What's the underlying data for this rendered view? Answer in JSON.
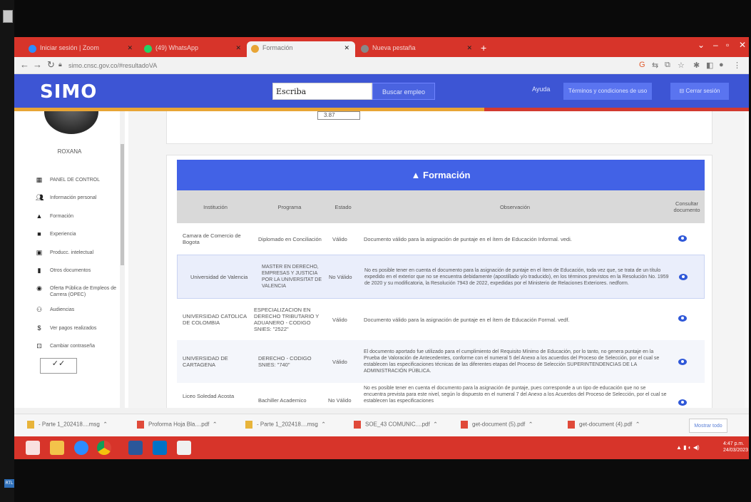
{
  "browser": {
    "tabs": [
      {
        "label": "Iniciar sesión | Zoom",
        "active": false,
        "color": "#2d8cff"
      },
      {
        "label": "(49) WhatsApp",
        "active": false,
        "color": "#25d366"
      },
      {
        "label": "Formación",
        "active": true,
        "color": "#e8a536"
      },
      {
        "label": "Nueva pestaña",
        "active": false,
        "color": "#888888"
      }
    ],
    "url": "simo.cnsc.gov.co/#resultadoVA"
  },
  "site": {
    "logo": "SIMO",
    "search_value": "Escriba",
    "search_button": "Buscar empleo",
    "help": "Ayuda",
    "terms_button": "Términos y condiciones de uso",
    "logout_button": "Cerrar sesión"
  },
  "sidebar": {
    "username": "ROXANA",
    "items": [
      {
        "label": "PANEL DE CONTROL",
        "icon": "dashboard-icon"
      },
      {
        "label": "Información personal",
        "icon": "people-icon"
      },
      {
        "label": "Formación",
        "icon": "graduation-icon"
      },
      {
        "label": "Experiencia",
        "icon": "briefcase-icon"
      },
      {
        "label": "Producc. intelectual",
        "icon": "book-icon"
      },
      {
        "label": "Otros documentos",
        "icon": "document-icon"
      },
      {
        "label": "Oferta Pública de Empleos de Carrera (OPEC)",
        "icon": "globe-icon"
      },
      {
        "label": "Audiencias",
        "icon": "audience-icon"
      },
      {
        "label": "Ver pagos realizados",
        "icon": "dollar-icon"
      },
      {
        "label": "Cambiar contraseña",
        "icon": "lock-icon"
      }
    ]
  },
  "main": {
    "score": "3.87",
    "section_title": "Formación",
    "columns": [
      "Institución",
      "Programa",
      "Estado",
      "Observación",
      "Consultar documento"
    ],
    "rows": [
      {
        "institucion": "Camara de Comercio de Bogota",
        "programa": "Diplomado en Conciliación",
        "estado": "Válido",
        "observacion": "Documento válido para la asignación de puntaje en el ítem de Educación Informal. vedi."
      },
      {
        "institucion": "Universidad de Valencia",
        "programa": "MASTER EN DERECHO, EMPRESAS Y JUSTICIA POR LA UNIVERSITAT DE VALENCIA",
        "estado": "No Válido",
        "observacion": "No es posible tener en cuenta el documento para la asignación de puntaje en el ítem de Educación, toda vez que, se trata de un título expedido en el exterior que no se encuentra debidamente (apostillado y/o traducido), en los términos previstos en la Resolución No. 1959 de 2020 y su modificatoria, la Resolución 7943 de 2022, expedidas por el Ministerio de Relaciones Exteriores. nedform."
      },
      {
        "institucion": "UNIVERSIDAD CATOLICA DE COLOMBIA",
        "programa": "ESPECIALIZACION EN DERECHO TRIBUTARIO Y ADUANERO - CODIGO SNIES: \"2522\"",
        "estado": "Válido",
        "observacion": "Documento válido para la asignación de puntaje en el ítem de Educación Formal. vedf."
      },
      {
        "institucion": "UNIVERSIDAD DE CARTAGENA",
        "programa": "DERECHO - CODIGO SNIES: \"740\"",
        "estado": "Válido",
        "observacion": "El documento aportado fue utilizado para el cumplimiento del Requisito Mínimo de Educación, por lo tanto, no genera puntaje en la Prueba de Valoración de Antecedentes, conforme con el numeral 5 del Anexo a los acuerdos del Proceso de Selección, por el cual se establecen las especificaciones técnicas de las diferentes etapas del Proceso de Selección SUPERINTENDENCIAS DE LA ADMINISTRACIÓN PÚBLICA."
      },
      {
        "institucion": "Liceo Soledad Acosta",
        "programa": "Bachiller Academico",
        "estado": "No Válido",
        "observacion": "No es posible tener en cuenta el documento para la asignación de puntaje, pues corresponde a un tipo de educación que no se encuentra prevista para este nivel, según lo dispuesto en el numeral 7 del Anexo a los Acuerdos del Proceso de Selección, por el cual se establecen las especificaciones"
      }
    ]
  },
  "downloads": {
    "items": [
      {
        "label": "- Parte 1_202418....msg",
        "type": "msg"
      },
      {
        "label": "Proforma Hoja Bla....pdf",
        "type": "pdf"
      },
      {
        "label": "- Parte 1_202418....msg",
        "type": "msg"
      },
      {
        "label": "SOE_43 COMUNIC....pdf",
        "type": "pdf"
      },
      {
        "label": "get-document (5).pdf",
        "type": "pdf"
      },
      {
        "label": "get-document (4).pdf",
        "type": "pdf"
      }
    ],
    "show_all": "Mostrar todo"
  },
  "taskbar": {
    "time": "4:47 p.m.",
    "date": "24/03/2023"
  }
}
